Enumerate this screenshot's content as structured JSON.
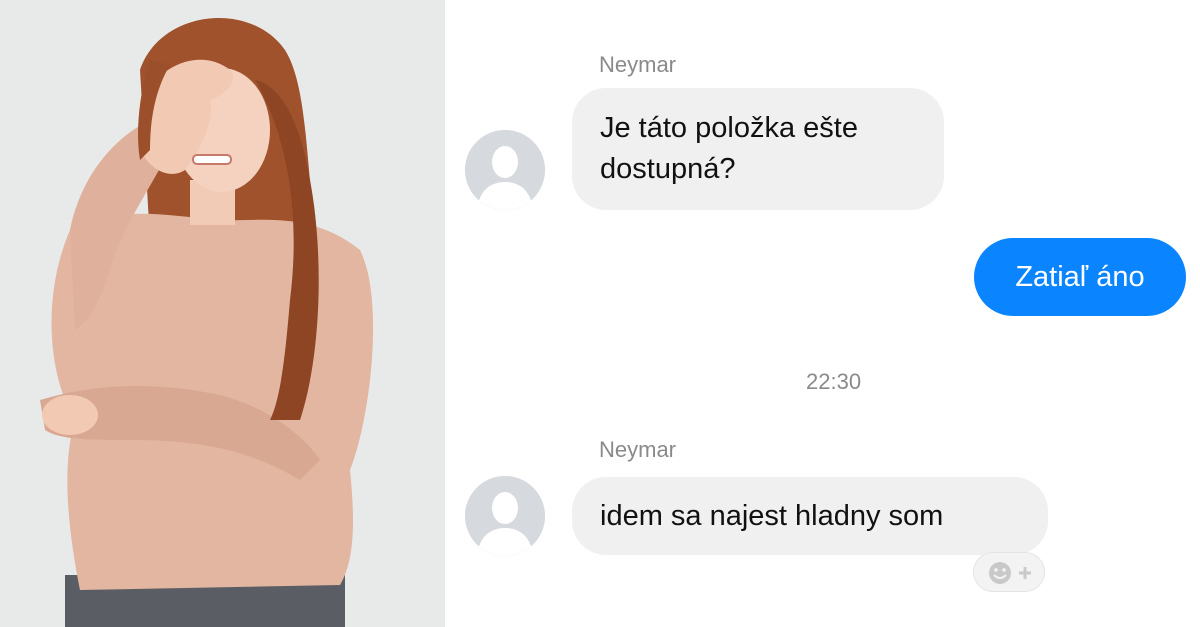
{
  "photo": {
    "icon": "woman-facepalm-photo"
  },
  "messages": [
    {
      "sender": "Neymar",
      "lines": [
        "Je táto položka ešte",
        "dostupná?"
      ]
    },
    {
      "text": "Zatiaľ áno"
    },
    {
      "sender": "Neymar",
      "text": "idem sa najest hladny som"
    }
  ],
  "timestamp": "22:30",
  "colors": {
    "outgoing_bubble": "#0a84ff",
    "incoming_bubble": "#f0f0f0",
    "meta_text": "#8a8a8a"
  },
  "icons": {
    "avatar": "default-avatar-icon",
    "reaction": "add-reaction-icon"
  }
}
